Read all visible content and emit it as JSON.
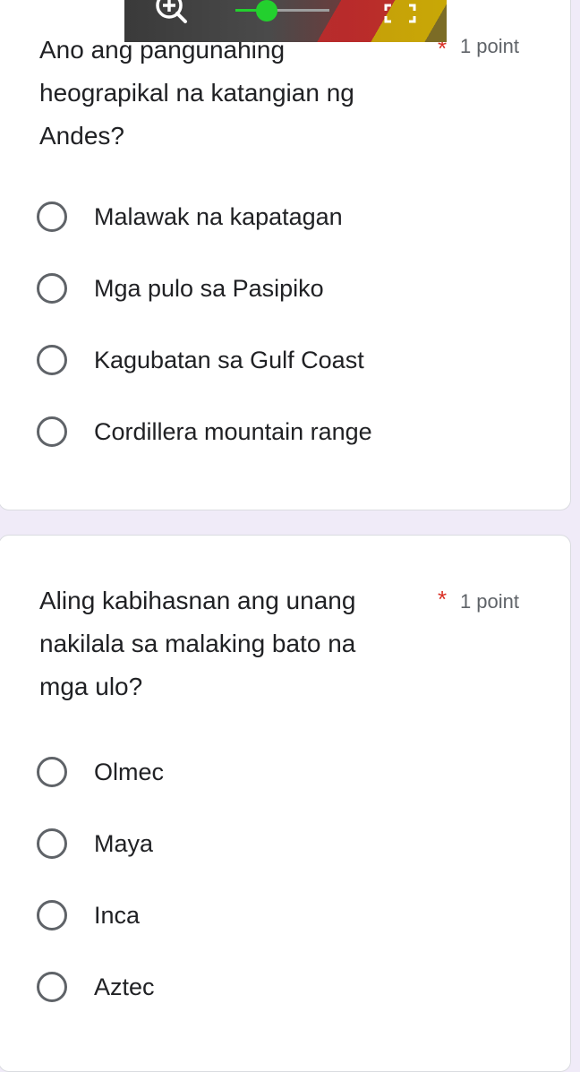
{
  "questions": [
    {
      "text_line1": "Ano ang pangunahing",
      "text_line2": "heograpikal na katangian ng",
      "text_line3": "Andes?",
      "required_mark": "*",
      "points": "1 point",
      "options": [
        "Malawak na kapatagan",
        "Mga pulo sa Pasipiko",
        "Kagubatan sa Gulf Coast",
        "Cordillera mountain range"
      ]
    },
    {
      "text_line1": "Aling kabihasnan ang unang",
      "text_line2": "nakilala sa malaking bato na",
      "text_line3": "mga ulo?",
      "required_mark": "*",
      "points": "1 point",
      "options": [
        "Olmec",
        "Maya",
        "Inca",
        "Aztec"
      ]
    }
  ],
  "toolbar": {
    "zoom_icon": "zoom-in-icon",
    "zoom_slider_level": 0.33,
    "fullscreen_icon": "fullscreen-icon"
  },
  "colors": {
    "background": "#f0ebf8",
    "required": "#d93025",
    "slider_accent": "#23d02e"
  }
}
